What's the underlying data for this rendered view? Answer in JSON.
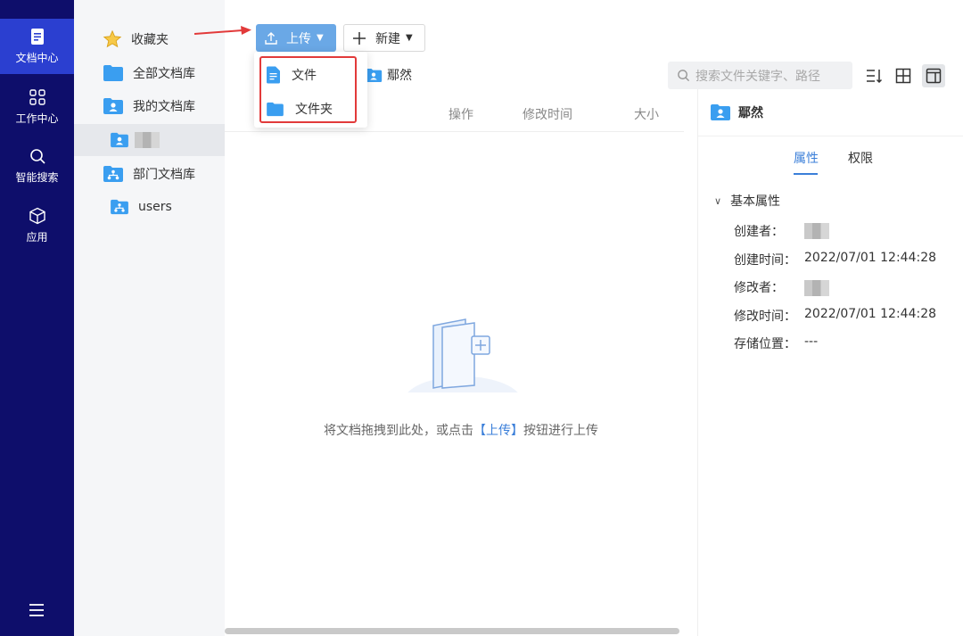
{
  "rail": {
    "items": [
      {
        "label": "文档中心",
        "icon": "document-icon",
        "active": true
      },
      {
        "label": "工作中心",
        "icon": "grid-icon"
      },
      {
        "label": "智能搜索",
        "icon": "search-icon"
      },
      {
        "label": "应用",
        "icon": "cube-icon"
      }
    ],
    "menu_icon": "hamburger-menu-icon"
  },
  "tree": {
    "items": [
      {
        "label": "收藏夹",
        "icon": "star-icon"
      },
      {
        "label": "全部文档库",
        "icon": "folder-icon"
      },
      {
        "label": "我的文档库",
        "icon": "user-folder-icon"
      },
      {
        "label": "",
        "icon": "user-folder-icon",
        "selected": true
      },
      {
        "label": "部门文档库",
        "icon": "org-folder-icon"
      },
      {
        "label": "users",
        "icon": "org-folder-icon"
      }
    ]
  },
  "toolbar": {
    "upload_label": "上传",
    "new_label": "新建",
    "search_placeholder": "搜索文件关键字、路径"
  },
  "dropdown": {
    "items": [
      {
        "label": "文件",
        "icon": "file-icon"
      },
      {
        "label": "文件夹",
        "icon": "folder-icon"
      }
    ]
  },
  "breadcrumb": {
    "current": "鄢然"
  },
  "columns": {
    "actions": "操作",
    "modified": "修改时间",
    "size": "大小"
  },
  "empty": {
    "text_before": "将文档拖拽到此处，或点击",
    "link": "【上传】",
    "text_after": "按钮进行上传"
  },
  "details": {
    "title": "鄢然",
    "tabs": [
      "属性",
      "权限"
    ],
    "section": "基本属性",
    "props": [
      {
        "label": "创建者：",
        "value": ""
      },
      {
        "label": "创建时间：",
        "value": "2022/07/01 12:44:28"
      },
      {
        "label": "修改者：",
        "value": ""
      },
      {
        "label": "修改时间：",
        "value": "2022/07/01 12:44:28"
      },
      {
        "label": "存储位置：",
        "value": "---"
      }
    ]
  },
  "colors": {
    "rail_bg": "#0e0e6b",
    "rail_active": "#2b3fd0",
    "accent": "#3b7fd9",
    "upload_btn": "#6aa8e6",
    "highlight_box": "#e23a3a"
  }
}
